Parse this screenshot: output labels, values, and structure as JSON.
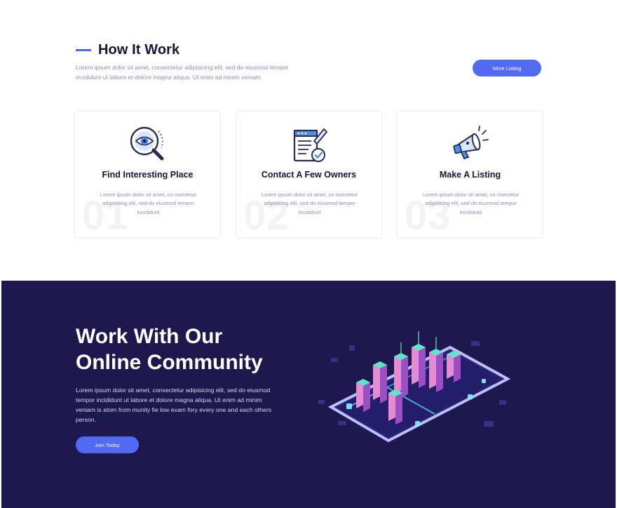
{
  "how_it_works": {
    "title": "How It Work",
    "description": "Lorem ipsum dolor sit amet, consectetur adipisicing elit, sed do eiusmod tempor incididunt ut labore et dolore magna aliqua. Ut enim ad minim veniam.",
    "more_button": "More Listing",
    "cards": [
      {
        "icon": "search-eye-icon",
        "title": "Find Interesting Place",
        "number": "01",
        "text": "Lorem ipsum dolor sit amet, co nsectetur adipisicing elit, sed do eiusmod tempor incididunt"
      },
      {
        "icon": "clipboard-check-icon",
        "title": "Contact A Few Owners",
        "number": "02",
        "text": "Lorem ipsum dolor sit amet, co nsectetur adipisicing elit, sed do eiusmod tempor incididunt"
      },
      {
        "icon": "megaphone-icon",
        "title": "Make A Listing",
        "number": "03",
        "text": "Lorem ipsum dolor sit amet, co nsectetur adipisicing elit, sed do eiusmod tempor incididunt"
      }
    ]
  },
  "community": {
    "title_line1": "Work With Our",
    "title_line2": "Online Community",
    "description": "Lorem ipsum dolor sit amet, consectetur adipisicing elit, sed do eiusmod tempor incididunt ut labore et dolore magna aliqua. Ut enim ad minim veniam is atom from munity fie low exam fory every one and each others person.",
    "join_button": "Join Today",
    "illustration": "isometric-city-phone-illustration"
  },
  "colors": {
    "accent": "#5169f3",
    "heading": "#14143a",
    "muted_text": "#8a8fa8",
    "dark_section_bg": "#1f184f"
  }
}
